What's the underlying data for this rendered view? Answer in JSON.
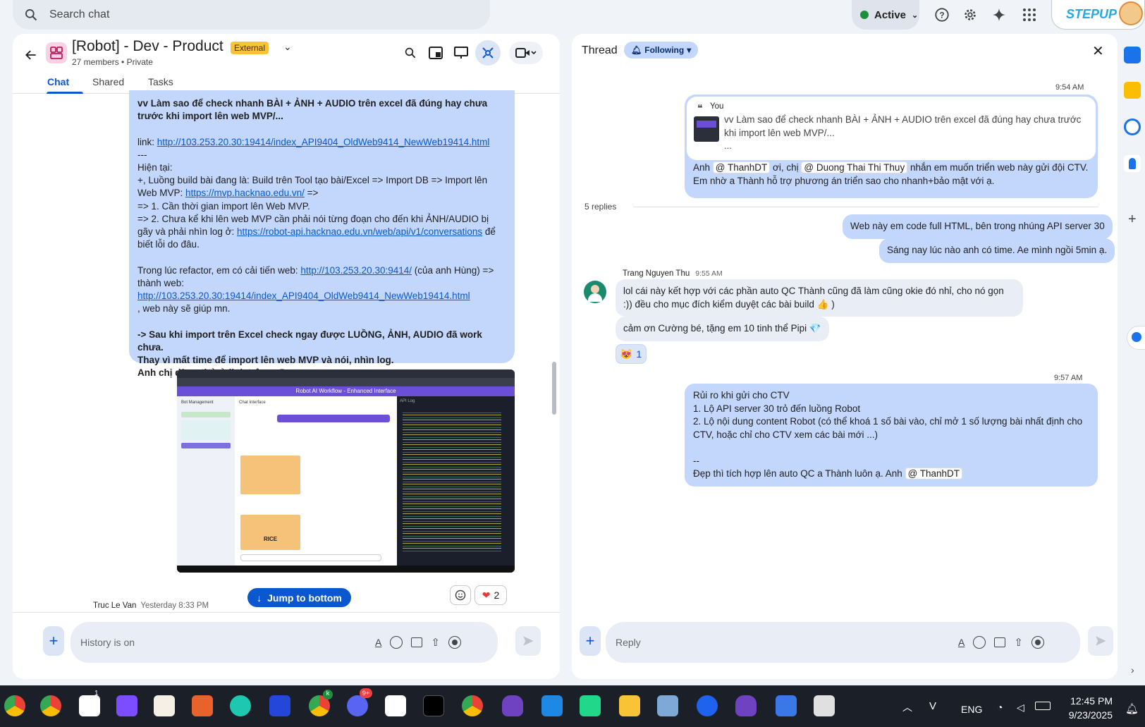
{
  "search": {
    "placeholder": "Search chat"
  },
  "status": {
    "label": "Active"
  },
  "brand": {
    "logo_text": "STEPUP"
  },
  "space": {
    "title": "[Robot] - Dev - Product",
    "external_badge": "External",
    "members": "27 members",
    "privacy": "Private",
    "tabs": [
      "Chat",
      "Shared",
      "Tasks"
    ]
  },
  "message": {
    "line1": "vv Làm sao để check nhanh  BÀI + ẢNH + AUDIO trên excel đã đúng hay chưa trước khi import lên web MVP/...",
    "link_label": "link: ",
    "link_url": "http://103.253.20.30:19414/index_API9404_OldWeb9414_NewWeb19414.html",
    "sep": "---",
    "current": "Hiện tại:",
    "flow_prefix": "+, Luồng build bài đang là: Build trên Tool tạo bài/Excel => Import DB => Import lên Web MVP: ",
    "mvp_url": "https://mvp.hacknao.edu.vn/",
    "flow_suffix": " =>",
    "point1": "=> 1. Cần thời gian import lên Web MVP.",
    "point2_prefix": "=> 2. Chưa kể khi lên web MVP cần phải nói từng đoạn cho đến khi ẢNH/AUDIO bị gãy và phải nhìn log ở:  ",
    "api_url": "https://robot-api.hacknao.edu.vn/web/api/v1/conversations",
    "point2_suffix": " để biết lỗi do đâu.",
    "refactor_prefix": "Trong lúc refactor, em có cải tiến web: ",
    "old_url": "http://103.253.20.30:9414/",
    "refactor_mid": " (của anh Hùng) => thành web: ",
    "new_url": "http://103.253.20.30:19414/index_API9404_OldWeb9414_NewWeb19414.html",
    "refactor_suffix": " , web này sẽ giúp mn.",
    "conclusion1": "-> Sau khi import trên Excel check ngay được LUỒNG, ẢNH, AUDIO đã work chưa.",
    "conclusion2": "Thay vì mất time để import lên web MVP và nói, nhìn log.",
    "conclusion3": "Anh chị dùng thử ở link trên ạ :D"
  },
  "screenshot": {
    "header": "Robot AI Workflow - Enhanced Interface",
    "left_title": "Bot Management",
    "mid_title": "Chat Interface",
    "right_title": "API Log",
    "item_label": "RICE"
  },
  "jump": {
    "label": "Jump to bottom"
  },
  "reactions_main": {
    "heart_count": "2"
  },
  "next_sender": {
    "name": "Truc Le Van",
    "time": "Yesterday 8:33 PM"
  },
  "composer_main": {
    "placeholder": "History is on"
  },
  "thread": {
    "title": "Thread",
    "following": "Following",
    "time1": "9:54 AM",
    "quote_author": "You",
    "quote_text": "vv Làm sao để check nhanh  BÀI + ẢNH + AUDIO trên excel đã đúng hay chưa trước khi import lên web MVP/...",
    "quote_more": "...",
    "root_prefix": "Anh ",
    "mention1": "@ ThanhDT",
    "root_mid": " ơi, chị ",
    "mention2": "@ Duong Thai Thi Thuy",
    "root_suffix": " nhắn em muốn triển web này gửi đội CTV. Em nhờ a Thành hỗ trợ phương án triển sao cho nhanh+bảo mật với ạ.",
    "replies": "5 replies",
    "reply1": "Web này em code full HTML, bên trong nhúng API server 30",
    "reply2": "Sáng nay lúc nào anh có time. Ae mình ngồi 5min ạ.",
    "trang_name": "Trang Nguyen Thu",
    "trang_time": "9:55 AM",
    "trang_msg1": "lol cái này kết hợp với các phần auto QC Thành cũng đã làm cũng okie đó nhỉ, cho nó gọn :)) đều cho mục đích kiểm duyệt các bài build 👍 )",
    "trang_msg2": "cảm ơn Cường bé, tặng em 10 tinh thể Pipi 💎",
    "trang_reaction": "1",
    "time2": "9:57 AM",
    "last_l1": "Rủi ro khi gửi cho CTV",
    "last_l2": "1. Lộ API server 30 trỏ đến luồng Robot",
    "last_l3": "2. Lộ nội dung content Robot (có thể khoá 1 số bài vào, chỉ mở 1 số lượng bài nhất định cho CTV, hoặc chỉ cho CTV xem các bài mới ...)",
    "last_l4": "--",
    "last_l5_prefix": "Đẹp thì tích hợp lên auto QC a Thành luôn ạ. Anh ",
    "mention3": "@ ThanhDT",
    "reply_placeholder": "Reply"
  },
  "taskbar": {
    "lang": "ENG",
    "time": "12:45 PM",
    "date": "9/23/2025",
    "badge_discord": "9+",
    "badge_1": "1",
    "badge_k": "k"
  }
}
